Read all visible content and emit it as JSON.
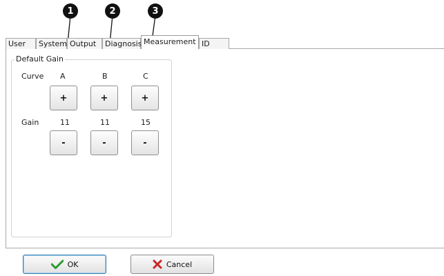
{
  "callouts": [
    "1",
    "2",
    "3"
  ],
  "tabs": [
    {
      "label": "User"
    },
    {
      "label": "System"
    },
    {
      "label": "Output"
    },
    {
      "label": "Diagnosis"
    },
    {
      "label": "Measurement",
      "active": true
    },
    {
      "label": "ID"
    }
  ],
  "group": {
    "title": "Default Gain",
    "curve_label": "Curve",
    "gain_label": "Gain",
    "channels": [
      {
        "curve": "A",
        "gain": "11",
        "plus": "+",
        "minus": "-"
      },
      {
        "curve": "B",
        "gain": "11",
        "plus": "+",
        "minus": "-"
      },
      {
        "curve": "C",
        "gain": "15",
        "plus": "+",
        "minus": "-"
      }
    ]
  },
  "buttons": {
    "ok": {
      "label": "OK",
      "icon": "checkmark-icon",
      "icon_color": "#2e9a2e"
    },
    "cancel": {
      "label": "Cancel",
      "icon": "x-icon",
      "icon_color": "#c62828"
    }
  }
}
